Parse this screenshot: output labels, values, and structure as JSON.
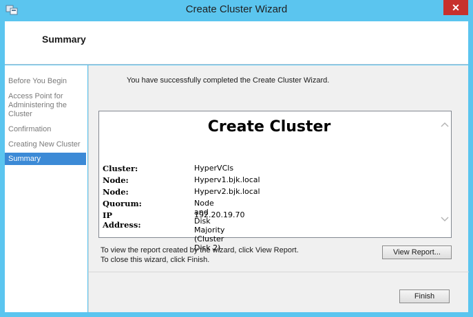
{
  "window": {
    "title": "Create Cluster Wizard",
    "close_glyph": "✕"
  },
  "header": {
    "title": "Summary"
  },
  "sidebar": {
    "items": [
      {
        "label": "Before You Begin",
        "active": false
      },
      {
        "label": "Access Point for Administering the Cluster",
        "active": false
      },
      {
        "label": "Confirmation",
        "active": false
      },
      {
        "label": "Creating New Cluster",
        "active": false
      },
      {
        "label": "Summary",
        "active": true
      }
    ]
  },
  "main": {
    "success_message": "You have successfully completed the Create Cluster Wizard.",
    "report": {
      "heading": "Create Cluster",
      "rows": [
        {
          "label": "Cluster:",
          "value": "HyperVCls"
        },
        {
          "label": "Node:",
          "value": "Hyperv1.bjk.local"
        },
        {
          "label": "Node:",
          "value": "Hyperv2.bjk.local"
        },
        {
          "label": "Quorum:",
          "value": "Node and Disk Majority (Cluster Disk 2)"
        },
        {
          "label": "IP Address:",
          "value": "192.20.19.70"
        }
      ]
    },
    "hint_view_report": "To view the report created by the wizard, click View Report.",
    "hint_finish": "To close this wizard, click Finish.",
    "view_report_label": "View Report...",
    "finish_label": "Finish"
  },
  "icons": {
    "app": "cluster-wizard-icon",
    "close": "close-icon",
    "scroll_up": "chevron-up-icon",
    "scroll_down": "chevron-down-icon"
  },
  "colors": {
    "titlebar": "#5bc5ef",
    "close": "#c7312d",
    "selection": "#3c8ad6"
  }
}
